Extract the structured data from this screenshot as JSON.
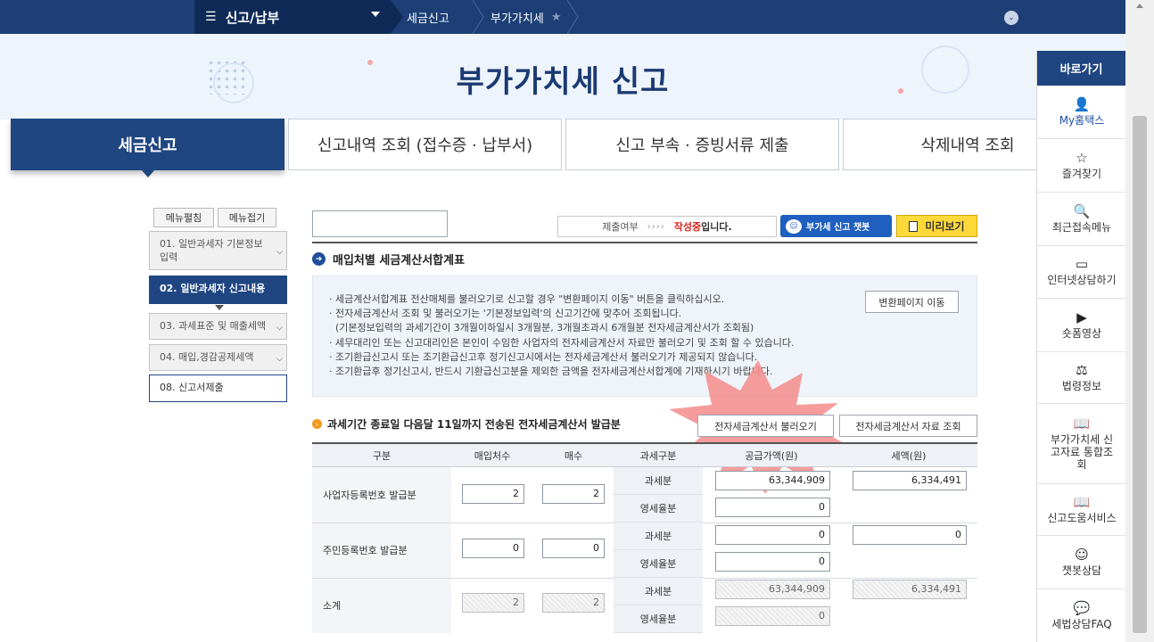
{
  "topnav": {
    "menu_label": "신고/납부",
    "crumbs": [
      "세금신고",
      "부가가치세"
    ],
    "star": "★"
  },
  "hero": {
    "title": "부가가치세 신고"
  },
  "tabs": [
    {
      "label": "세금신고"
    },
    {
      "label": "신고내역 조회 (접수증 · 납부서)"
    },
    {
      "label": "신고 부속 · 증빙서류 제출"
    },
    {
      "label": "삭제내역 조회"
    }
  ],
  "side": {
    "edit_label": "메뉴펼침",
    "collapse_label": "메뉴접기",
    "steps": [
      {
        "label": "01. 일반과세자 기본정보입력"
      },
      {
        "label": "02. 일반과세자 신고내용"
      },
      {
        "label": "03. 과세표준 및 매출세액"
      },
      {
        "label": "04. 매입,경감공제세액"
      },
      {
        "label": "08. 신고서제출"
      }
    ]
  },
  "status": {
    "prefix": "제출여부",
    "arrows": "›››› ",
    "writing": "작성중",
    "suffix": "입니다."
  },
  "chatbot_label": "부가세 신고 챗봇",
  "preview_label": "미리보기",
  "section_title": "매입처별 세금계산서합계표",
  "notices": [
    "· 세금계산서합계표 전산매체를 불러오기로 신고할 경우 \"변환페이지 이동\" 버튼을 클릭하십시오.",
    "· 전자세금계산서 조회 및 불러오기는 '기본정보입력'의 신고기간에 맞추어 조회됩니다.",
    "  (기본정보입력의 과세기간이 3개월이하일시 3개월분, 3개월초과시 6개월분 전자세금계산서가 조회됨)",
    "· 세무대리인 또는 신고대리인은 본인이 수임한 사업자의 전자세금계산서 자료만 불러오기 및 조회 할 수 있습니다.",
    "· 조기환급신고시 또는 조기환급신고후 정기신고시에서는 전자세금계산서 불러오기가 제공되지 않습니다.",
    "· 조기환급후 정기신고시, 반드시 기환급신고분을 제외한 금액을 전자세금계산서합계에 기재하시기 바랍니다."
  ],
  "convert_label": "변환페이지 이동",
  "sub_title": "과세기간 종료일 다음달 11일까지 전송된 전자세금계산서 발급분",
  "load_label": "전자세금계산서 불러오기",
  "lookup_label": "전자세금계산서 자료 조회",
  "table": {
    "headers": [
      "구분",
      "매입처수",
      "매수",
      "과세구분",
      "공급가액(원)",
      "세액(원)"
    ],
    "rows": [
      {
        "label": "사업자등록번호 발급분",
        "suppliers": "2",
        "count": "2",
        "taxable": {
          "type": "과세분",
          "amount": "63,344,909",
          "tax": "6,334,491"
        },
        "zero": {
          "type": "영세율분",
          "amount": "0"
        }
      },
      {
        "label": "주민등록번호 발급분",
        "suppliers": "0",
        "count": "0",
        "taxable": {
          "type": "과세분",
          "amount": "0",
          "tax": "0"
        },
        "zero": {
          "type": "영세율분",
          "amount": "0"
        }
      },
      {
        "label": "소계",
        "suppliers": "2",
        "count": "2",
        "taxable": {
          "type": "과세분",
          "amount": "63,344,909",
          "tax": "6,334,491"
        },
        "zero": {
          "type": "영세율분",
          "amount": "0"
        }
      }
    ]
  },
  "quick": {
    "title": "바로가기",
    "items": [
      {
        "label": "My홈택스",
        "icon": "user-icon",
        "glyph": "👤"
      },
      {
        "label": "즐겨찾기",
        "icon": "star-icon",
        "glyph": "☆"
      },
      {
        "label": "최근접속메뉴",
        "icon": "recent-icon",
        "glyph": "🔍"
      },
      {
        "label": "인터넷상담하기",
        "icon": "monitor-icon",
        "glyph": "▭"
      },
      {
        "label": "숏폼영상",
        "icon": "play-icon",
        "glyph": "▶"
      },
      {
        "label": "법령정보",
        "icon": "gavel-icon",
        "glyph": "⚖"
      },
      {
        "label": "부가가치세 신고자료 통합조회",
        "icon": "book-icon",
        "glyph": "📖"
      },
      {
        "label": "신고도움서비스",
        "icon": "book-open-icon",
        "glyph": "📖"
      },
      {
        "label": "챗봇상담",
        "icon": "chatbot-icon",
        "glyph": "☺"
      },
      {
        "label": "세법상담FAQ",
        "icon": "faq-icon",
        "glyph": "💬"
      }
    ]
  }
}
